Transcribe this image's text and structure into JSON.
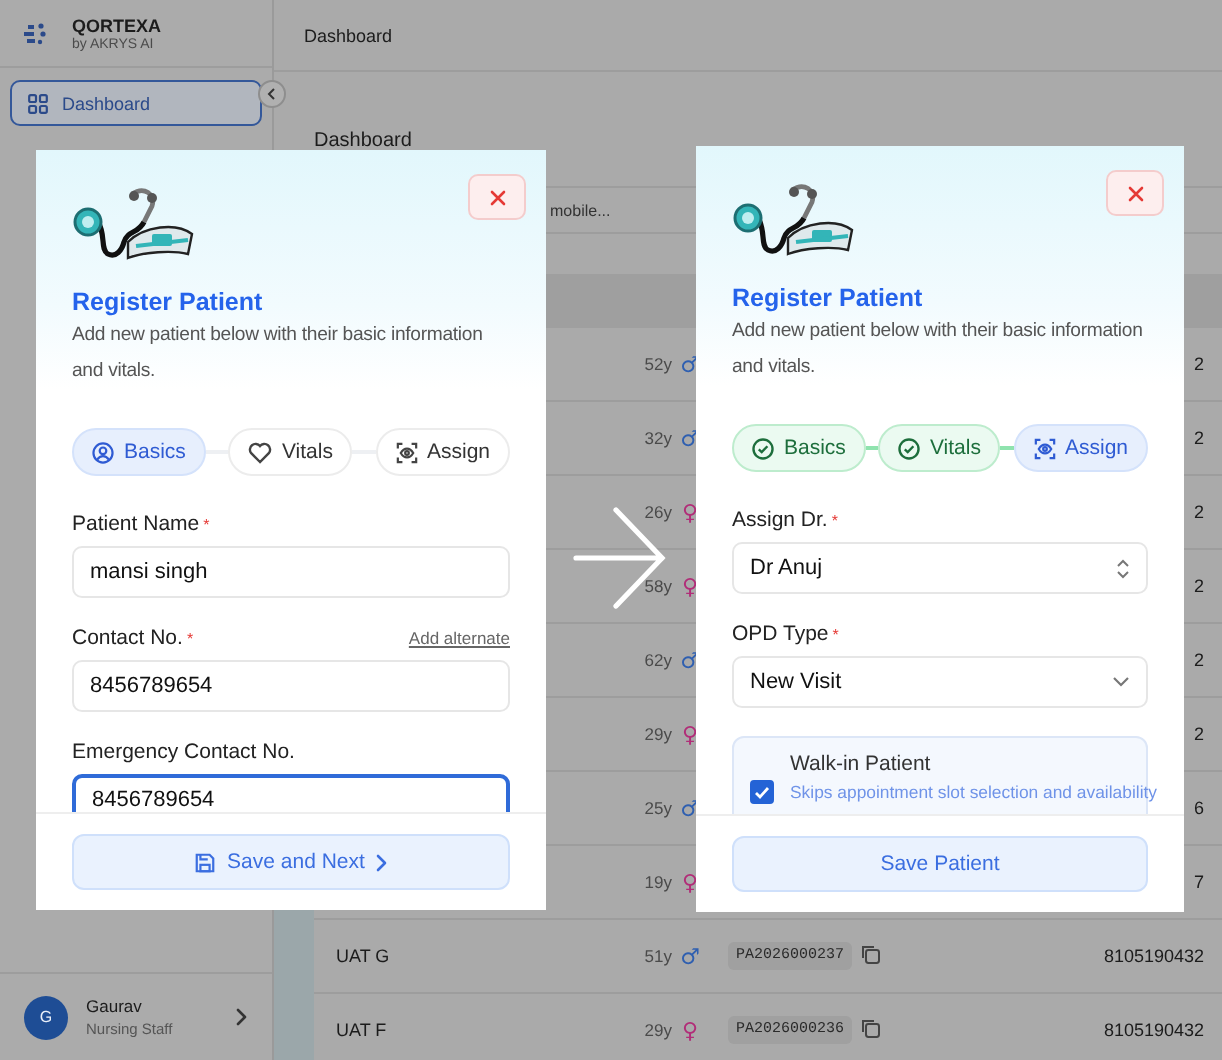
{
  "sidebar": {
    "brand": "QORTEXA",
    "brand_sub": "by AKRYS AI",
    "items": [
      {
        "label": "Dashboard",
        "selected": true
      }
    ],
    "user": {
      "initial": "G",
      "name": "Gaurav",
      "role": "Nursing Staff"
    }
  },
  "header": {
    "title": "Dashboard"
  },
  "page": {
    "title": "Dashboard",
    "search": {
      "placeholder": "mobile..."
    }
  },
  "table": {
    "rows": [
      {
        "age": "52y",
        "gender": "♂",
        "color": "#2f5fb0",
        "phone": "2"
      },
      {
        "age": "32y",
        "gender": "♂",
        "color": "#2f5fb0",
        "phone": "2"
      },
      {
        "age": "26y",
        "gender": "♀",
        "color": "#b12d78",
        "phone": "2"
      },
      {
        "age": "58y",
        "gender": "♀",
        "color": "#b12d78",
        "phone": "2"
      },
      {
        "age": "62y",
        "gender": "♂",
        "color": "#2f5fb0",
        "phone": "2"
      },
      {
        "age": "29y",
        "gender": "♀",
        "color": "#b12d78",
        "phone": "2"
      },
      {
        "age": "25y",
        "gender": "♂",
        "color": "#2f5fb0",
        "phone": "6"
      },
      {
        "age": "19y",
        "gender": "♀",
        "color": "#b12d78",
        "phone": "7"
      },
      {
        "name": "UAT G",
        "age": "51y",
        "gender": "♂",
        "color": "#2f5fb0",
        "patient_id": "PA2026000237",
        "phone": "8105190432"
      },
      {
        "name": "UAT F",
        "age": "29y",
        "gender": "♀",
        "color": "#b12d78",
        "patient_id": "PA2026000236",
        "phone": "8105190432"
      }
    ]
  },
  "modals": [
    {
      "title": "Register Patient",
      "description": "Add new patient below with their basic information and vitals.",
      "steps": [
        {
          "label": "Basics",
          "selected": true,
          "completed": false
        },
        {
          "label": "Vitals",
          "selected": false,
          "completed": false
        },
        {
          "label": "Assign",
          "selected": false,
          "completed": false
        }
      ],
      "fields": [
        {
          "kind": "input",
          "label": "Patient Name",
          "required_mark": "*",
          "value": "mansi singh",
          "focused": false
        },
        {
          "kind": "input",
          "label": "Contact No.",
          "required_mark": "*",
          "link": "Add alternate",
          "value": "8456789654",
          "focused": false
        },
        {
          "kind": "input",
          "label": "Emergency Contact No.",
          "value": "8456789654",
          "focused": true
        }
      ],
      "footer_button": {
        "label": "Save and Next",
        "kind": "next"
      }
    },
    {
      "title": "Register Patient",
      "description": "Add new patient below with their basic information and vitals.",
      "steps": [
        {
          "label": "Basics",
          "selected": false,
          "completed": true
        },
        {
          "label": "Vitals",
          "selected": false,
          "completed": true
        },
        {
          "label": "Assign",
          "selected": true,
          "completed": false
        }
      ],
      "fields": [
        {
          "kind": "combobox",
          "label": "Assign Dr.",
          "required_mark": "*",
          "value": "Dr Anuj"
        },
        {
          "kind": "select",
          "label": "OPD Type",
          "required_mark": "*",
          "value": "New Visit"
        },
        {
          "kind": "checkbox",
          "label": "Walk-in Patient",
          "description": "Skips appointment slot selection and availability",
          "checked": true
        }
      ],
      "footer_button": {
        "label": "Save Patient",
        "kind": "submit"
      }
    }
  ]
}
